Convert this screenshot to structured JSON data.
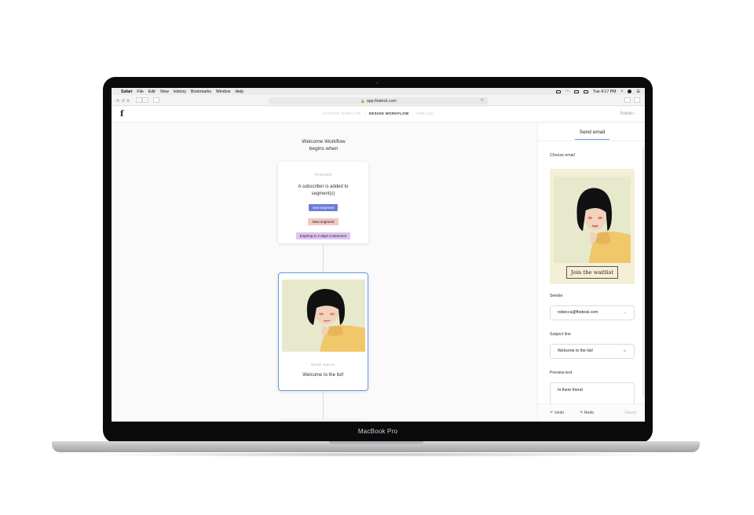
{
  "device": {
    "label": "MacBook Pro"
  },
  "menubar": {
    "app": "Safari",
    "items": [
      "File",
      "Edit",
      "View",
      "History",
      "Bookmarks",
      "Window",
      "Help"
    ],
    "clock": "Tue 4:17 PM"
  },
  "browser": {
    "url": "app.flodesk.com"
  },
  "app": {
    "logo": "f",
    "steps": [
      "CHOOSE TEMPLATE",
      "DESIGN WORKFLOW",
      "PUBLISH"
    ],
    "publish": "Publish ›"
  },
  "canvas": {
    "title": "Welcome Workflow\nbegins when",
    "trigger": {
      "label": "TRIGGER",
      "description": "A subscriber is added to segment(s)",
      "segments": [
        "new segment",
        "New segment",
        "Expiring in 2 days Customers"
      ]
    },
    "email_node": {
      "label": "SEND EMAIL",
      "subject": "Welcome to the list!"
    }
  },
  "panel": {
    "tab": "Send email",
    "choose_email_label": "Choose email",
    "waitlist_button": "Join the waitlist",
    "sender_label": "Sender",
    "sender_value": "rebecca@flodesk.com",
    "subject_label": "Subject line",
    "subject_value": "Welcome to the list!",
    "preview_label": "Preview text",
    "preview_value": "hi there friend",
    "undo": "Undo",
    "redo": "Redo",
    "saved": "Saved"
  },
  "colors": {
    "selected_border": "#5f9ae6",
    "chip_blue": "#6b7fd8",
    "chip_pink": "#f1c9c3",
    "chip_purple": "#ddc4f4",
    "tab_accent": "#6b8fe6"
  }
}
